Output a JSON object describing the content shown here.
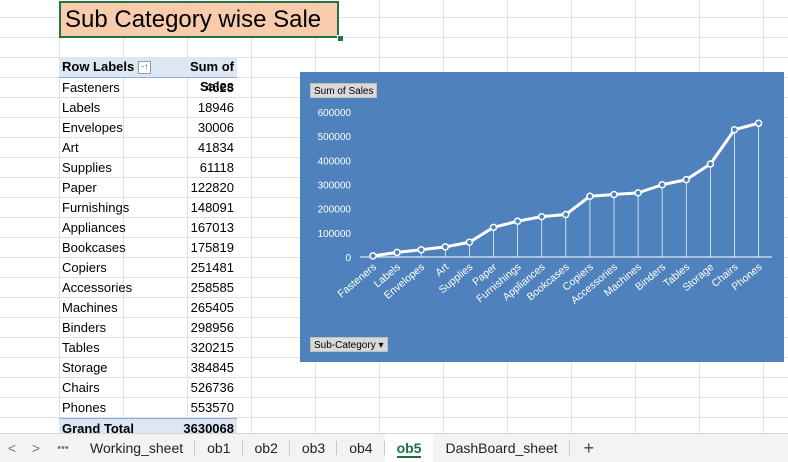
{
  "title": "Sub Category wise Sale",
  "pivot": {
    "header_label": "Row Labels",
    "header_value": "Sum of Sales",
    "filter_glyph": "-↑",
    "rows": [
      {
        "label": "Fasteners",
        "value": "4628"
      },
      {
        "label": "Labels",
        "value": "18946"
      },
      {
        "label": "Envelopes",
        "value": "30006"
      },
      {
        "label": "Art",
        "value": "41834"
      },
      {
        "label": "Supplies",
        "value": "61118"
      },
      {
        "label": "Paper",
        "value": "122820"
      },
      {
        "label": "Furnishings",
        "value": "148091"
      },
      {
        "label": "Appliances",
        "value": "167013"
      },
      {
        "label": "Bookcases",
        "value": "175819"
      },
      {
        "label": "Copiers",
        "value": "251481"
      },
      {
        "label": "Accessories",
        "value": "258585"
      },
      {
        "label": "Machines",
        "value": "265405"
      },
      {
        "label": "Binders",
        "value": "298956"
      },
      {
        "label": "Tables",
        "value": "320215"
      },
      {
        "label": "Storage",
        "value": "384845"
      },
      {
        "label": "Chairs",
        "value": "526736"
      },
      {
        "label": "Phones",
        "value": "553570"
      }
    ],
    "total_label": "Grand Total",
    "total_value": "3630068"
  },
  "chart_data": {
    "type": "line",
    "value_field_button": "Sum of Sales",
    "axis_field_button": "Sub-Category",
    "categories": [
      "Fasteners",
      "Labels",
      "Envelopes",
      "Art",
      "Supplies",
      "Paper",
      "Furnishings",
      "Appliances",
      "Bookcases",
      "Copiers",
      "Accessories",
      "Machines",
      "Binders",
      "Tables",
      "Storage",
      "Chairs",
      "Phones"
    ],
    "values": [
      4628,
      18946,
      30006,
      41834,
      61118,
      122820,
      148091,
      167013,
      175819,
      251481,
      258585,
      265405,
      298956,
      320215,
      384845,
      526736,
      553570
    ],
    "yticks": [
      "0",
      "100000",
      "200000",
      "300000",
      "400000",
      "500000",
      "600000"
    ],
    "ylim": [
      0,
      600000
    ],
    "background": "#4f81bd",
    "line_color": "#ffffff",
    "drop_lines": true,
    "grid": false
  },
  "sheet_tabs": {
    "nav_prev": "<",
    "nav_next": ">",
    "more": "•••",
    "tabs": [
      "Working_sheet",
      "ob1",
      "ob2",
      "ob3",
      "ob4",
      "ob5",
      "DashBoard_sheet"
    ],
    "active": "ob5",
    "add": "+"
  }
}
